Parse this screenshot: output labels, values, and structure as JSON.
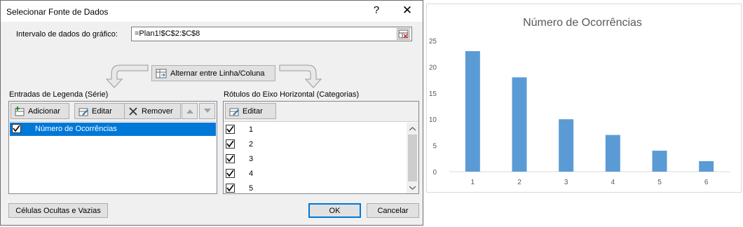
{
  "dialog": {
    "title": "Selecionar Fonte de Dados",
    "help_glyph": "?",
    "close_glyph": "✕",
    "range_label": "Intervalo de dados do gráfico:",
    "range_value": "=Plan1!$C$2:$C$8",
    "switch_label": "Alternar entre Linha/Coluna",
    "legend_section_label": "Entradas de Legenda (Série)",
    "add_label": "Adicionar",
    "edit_label": "Editar",
    "remove_label": "Remover",
    "series": [
      {
        "name": "Número de Ocorrências",
        "checked": true
      }
    ],
    "axis_section_label": "Rótulos do Eixo Horizontal (Categorias)",
    "axis_edit_label": "Editar",
    "categories": [
      {
        "label": "1",
        "checked": true
      },
      {
        "label": "2",
        "checked": true
      },
      {
        "label": "3",
        "checked": true
      },
      {
        "label": "4",
        "checked": true
      },
      {
        "label": "5",
        "checked": true
      }
    ],
    "hidden_cells_label": "Células Ocultas e Vazias",
    "ok_label": "OK",
    "cancel_label": "Cancelar"
  },
  "colors": {
    "bar": "#5b9bd5",
    "selection": "#0078d7",
    "primary_border": "#0078d7"
  },
  "chart_data": {
    "type": "bar",
    "title": "Número de Ocorrências",
    "categories": [
      "1",
      "2",
      "3",
      "4",
      "5",
      "6"
    ],
    "values": [
      23,
      18,
      10,
      7,
      4,
      2
    ],
    "ylim": [
      0,
      25
    ],
    "yticks": [
      0,
      5,
      10,
      15,
      20,
      25
    ],
    "grid": false,
    "legend": "none"
  }
}
